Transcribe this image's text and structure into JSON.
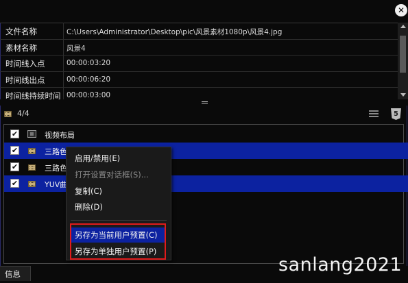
{
  "properties": [
    {
      "label": "文件名称",
      "value": "C:\\Users\\Administrator\\Desktop\\pic\\风景素材1080p\\风景4.jpg"
    },
    {
      "label": "素材名称",
      "value": "风景4"
    },
    {
      "label": "时间线入点",
      "value": "00:00:03:20"
    },
    {
      "label": "时间线出点",
      "value": "00:00:06:20"
    },
    {
      "label": "时间线持续时间",
      "value": "00:00:03:00"
    }
  ],
  "toolbar": {
    "count": "4/4"
  },
  "tracks": [
    {
      "label": "视频布局",
      "checked": "✔",
      "icon": "layout-icon",
      "selected": false
    },
    {
      "label": "三路色彩",
      "checked": "✔",
      "icon": "film-icon",
      "selected": true
    },
    {
      "label": "三路色彩",
      "checked": "✔",
      "icon": "film-icon",
      "selected": false
    },
    {
      "label": "YUV曲线",
      "checked": "✔",
      "icon": "film-icon",
      "selected": true
    }
  ],
  "context_menu": {
    "items": [
      {
        "label": "启用/禁用(E)",
        "disabled": false
      },
      {
        "label": "打开设置对话框(S)...",
        "disabled": true
      },
      {
        "label": "复制(C)",
        "disabled": false
      },
      {
        "label": "删除(D)",
        "disabled": false
      },
      {
        "label": "另存为当前用户预置(C)",
        "disabled": false
      },
      {
        "label": "另存为单独用户预置(P)",
        "disabled": false
      }
    ]
  },
  "bottom_tab": {
    "label": "信息"
  },
  "watermark": "sanlang2021",
  "colors": {
    "selection": "#0c22a0",
    "highlight_box": "#e21b1b",
    "background": "#0a0a0a"
  }
}
